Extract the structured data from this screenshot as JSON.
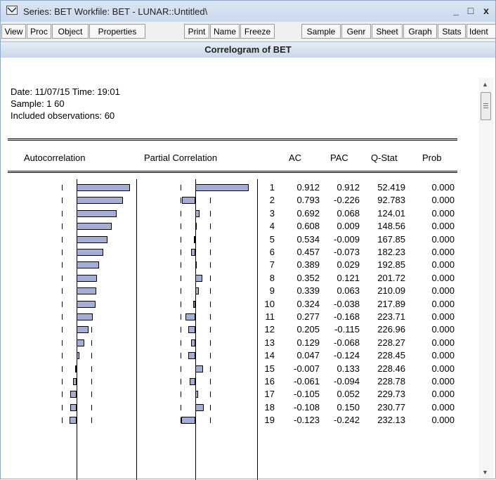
{
  "window": {
    "title": "Series: BET   Workfile: BET - LUNAR::Untitled\\",
    "minimize": "_",
    "maximize": "□",
    "close": "x"
  },
  "toolbar": {
    "buttons": [
      "View",
      "Proc",
      "Object",
      "Properties",
      "Print",
      "Name",
      "Freeze",
      "Sample",
      "Genr",
      "Sheet",
      "Graph",
      "Stats",
      "Ident"
    ]
  },
  "view_title": "Correlogram of BET",
  "meta": {
    "date_line": "Date: 11/07/15   Time: 19:01",
    "sample_line": "Sample: 1 60",
    "obs_line": "Included observations: 60"
  },
  "headers": {
    "autocorrelation": "Autocorrelation",
    "partial_correlation": "Partial Correlation",
    "ac": "AC",
    "pac": "PAC",
    "qstat": "Q-Stat",
    "prob": "Prob"
  },
  "rows": [
    {
      "lag": "1",
      "ac": "0.912",
      "pac": "0.912",
      "q": "52.419",
      "p": "0.000"
    },
    {
      "lag": "2",
      "ac": "0.793",
      "pac": "-0.226",
      "q": "92.783",
      "p": "0.000"
    },
    {
      "lag": "3",
      "ac": "0.692",
      "pac": "0.068",
      "q": "124.01",
      "p": "0.000"
    },
    {
      "lag": "4",
      "ac": "0.608",
      "pac": "0.009",
      "q": "148.56",
      "p": "0.000"
    },
    {
      "lag": "5",
      "ac": "0.534",
      "pac": "-0.009",
      "q": "167.85",
      "p": "0.000"
    },
    {
      "lag": "6",
      "ac": "0.457",
      "pac": "-0.073",
      "q": "182.23",
      "p": "0.000"
    },
    {
      "lag": "7",
      "ac": "0.389",
      "pac": "0.029",
      "q": "192.85",
      "p": "0.000"
    },
    {
      "lag": "8",
      "ac": "0.352",
      "pac": "0.121",
      "q": "201.72",
      "p": "0.000"
    },
    {
      "lag": "9",
      "ac": "0.339",
      "pac": "0.063",
      "q": "210.09",
      "p": "0.000"
    },
    {
      "lag": "10",
      "ac": "0.324",
      "pac": "-0.038",
      "q": "217.89",
      "p": "0.000"
    },
    {
      "lag": "11",
      "ac": "0.277",
      "pac": "-0.168",
      "q": "223.71",
      "p": "0.000"
    },
    {
      "lag": "12",
      "ac": "0.205",
      "pac": "-0.115",
      "q": "226.96",
      "p": "0.000"
    },
    {
      "lag": "13",
      "ac": "0.129",
      "pac": "-0.068",
      "q": "228.27",
      "p": "0.000"
    },
    {
      "lag": "14",
      "ac": "0.047",
      "pac": "-0.124",
      "q": "228.45",
      "p": "0.000"
    },
    {
      "lag": "15",
      "ac": "-0.007",
      "pac": "0.133",
      "q": "228.46",
      "p": "0.000"
    },
    {
      "lag": "16",
      "ac": "-0.061",
      "pac": "-0.094",
      "q": "228.78",
      "p": "0.000"
    },
    {
      "lag": "17",
      "ac": "-0.105",
      "pac": "0.052",
      "q": "229.73",
      "p": "0.000"
    },
    {
      "lag": "18",
      "ac": "-0.108",
      "pac": "0.150",
      "q": "230.77",
      "p": "0.000"
    },
    {
      "lag": "19",
      "ac": "-0.123",
      "pac": "-0.242",
      "q": "232.13",
      "p": "0.000"
    }
  ],
  "colors": {
    "bar_fill": "#a7aed4",
    "title_bar": "#c9d9ed"
  },
  "icons": {
    "title": "series-window-icon",
    "scroll_up": "scroll-up-arrow-icon",
    "scroll_down": "scroll-down-arrow-icon"
  }
}
